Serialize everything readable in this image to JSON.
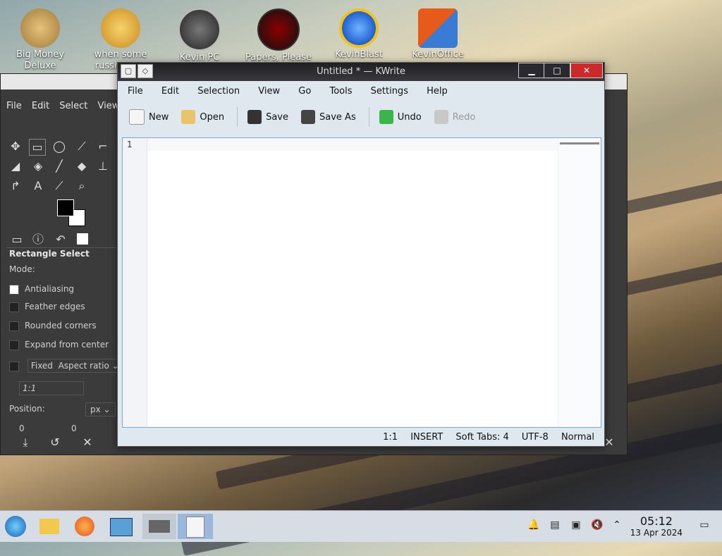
{
  "desktop_icons": [
    {
      "label": "Big Money Deluxe",
      "icon": "money-bag-icon"
    },
    {
      "label": "when some russian (un",
      "icon": "gear-icon"
    },
    {
      "label": "Kevin PC Optimizer Up",
      "icon": "gauge-icon"
    },
    {
      "label": "Papers, Please",
      "icon": "papers-please-icon"
    },
    {
      "label": "KevinBlast",
      "icon": "burst-icon"
    },
    {
      "label": "KevinOffice",
      "icon": "office-icon"
    }
  ],
  "gimp": {
    "menu": [
      "File",
      "Edit",
      "Select",
      "View"
    ],
    "tool_options_title": "Rectangle Select",
    "mode_label": "Mode:",
    "options": [
      "Antialiasing",
      "Feather edges",
      "Rounded corners",
      "Expand from center"
    ],
    "fixed_label": "Fixed",
    "fixed_value": "Aspect ratio",
    "ratio_value": "1:1",
    "position_label": "Position:",
    "position_unit": "px",
    "position_x": "0",
    "position_y": "0"
  },
  "kwrite": {
    "title": "Untitled * — KWrite",
    "menu": [
      "File",
      "Edit",
      "Selection",
      "View",
      "Go",
      "Tools",
      "Settings",
      "Help"
    ],
    "toolbar": {
      "new": "New",
      "open": "Open",
      "save": "Save",
      "save_as": "Save As",
      "undo": "Undo",
      "redo": "Redo"
    },
    "line_number": "1",
    "status": {
      "position": "1:1",
      "mode": "INSERT",
      "tabs": "Soft Tabs: 4",
      "encoding": "UTF-8",
      "input_mode": "Normal"
    }
  },
  "taskbar": {
    "clock_time": "05:12",
    "clock_date": "13 Apr 2024"
  },
  "colors": {
    "accent": "#7aa7d6",
    "close_button": "#cc2a2a",
    "taskbar": "#d6dde4"
  }
}
